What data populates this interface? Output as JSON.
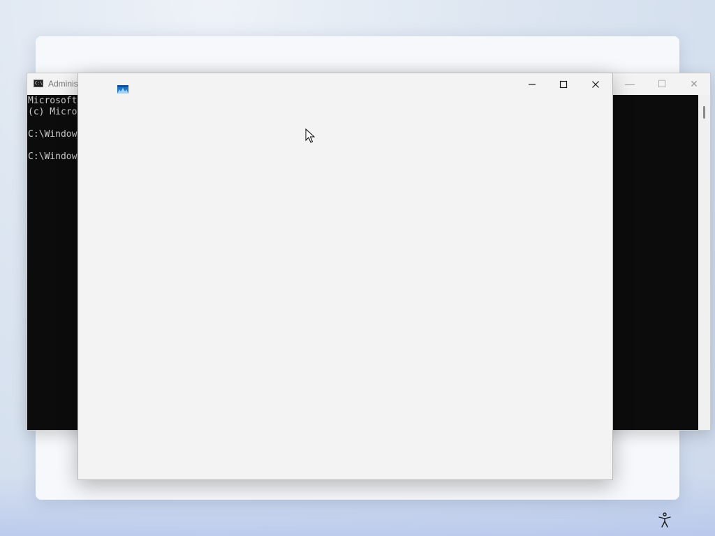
{
  "cmd_window": {
    "title": "Adminis",
    "icon_text": "C:\\",
    "minimize_glyph": "—",
    "maximize_glyph": "☐",
    "close_glyph": "✕",
    "console_lines": [
      "Microsoft",
      "(c) Micro",
      "",
      "C:\\Window",
      "",
      "C:\\Window"
    ]
  },
  "app_window": {
    "icon": "app-icon"
  },
  "taskbar": {
    "accessibility_icon": "accessibility-icon"
  },
  "colors": {
    "console_bg": "#0c0c0c",
    "console_text": "#cccccc",
    "window_bg": "#f3f3f3"
  }
}
